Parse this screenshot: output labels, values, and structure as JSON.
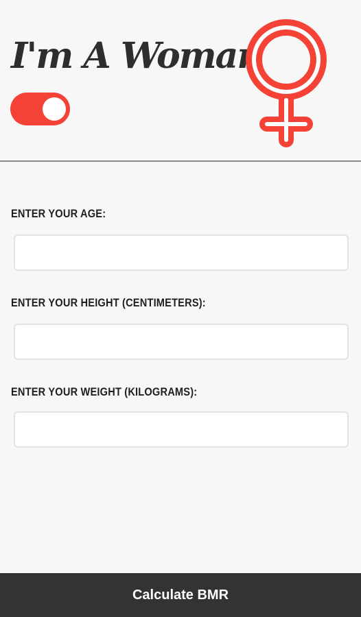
{
  "header": {
    "title": "I'm A Woman",
    "gender_toggle_on": true,
    "icon": "female-symbol-icon",
    "accent_color": "#f44336"
  },
  "form": {
    "age_label": "ENTER YOUR AGE:",
    "age_value": "",
    "height_label": "ENTER YOUR HEIGHT (CENTIMETERS):",
    "height_value": "",
    "weight_label": "ENTER YOUR WEIGHT (KILOGRAMS):",
    "weight_value": ""
  },
  "actions": {
    "calculate_label": "Calculate BMR"
  }
}
